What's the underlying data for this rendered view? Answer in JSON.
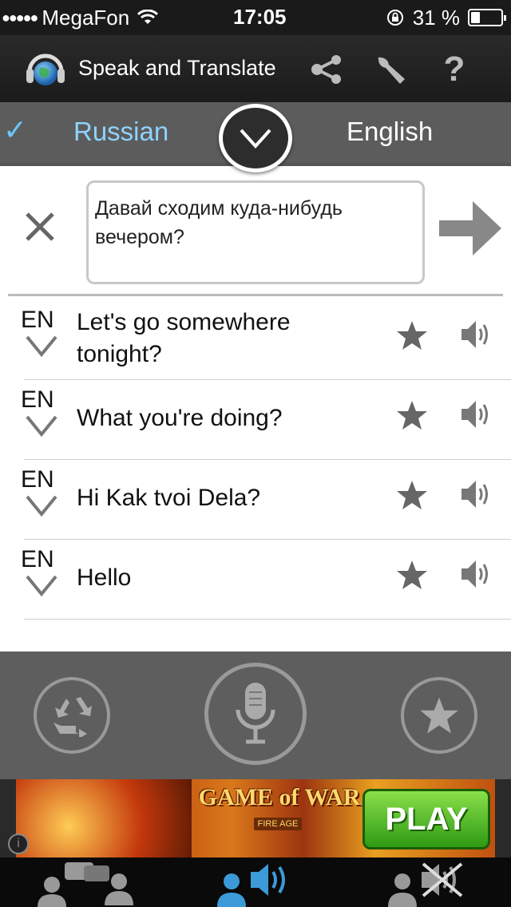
{
  "status_bar": {
    "carrier": "MegaFon",
    "time": "17:05",
    "battery_percent": "31 %",
    "battery_level": 0.31
  },
  "header": {
    "title": "Speak and Translate"
  },
  "languages": {
    "source": "Russian",
    "target": "English"
  },
  "input": {
    "text": "Давай сходим куда-нибудь вечером?"
  },
  "history": [
    {
      "code": "EN",
      "text": "Let's go somewhere tonight?"
    },
    {
      "code": "EN",
      "text": "What you're doing?"
    },
    {
      "code": "EN",
      "text": "Hi Kak tvoi Dela?"
    },
    {
      "code": "EN",
      "text": "Hello"
    }
  ],
  "ad": {
    "title": "GAME of WAR",
    "subtitle": "FIRE AGE",
    "cta": "PLAY"
  },
  "colors": {
    "accent": "#8ed3ff",
    "active_tab": "#3d9ad9",
    "panel": "#5e5e5e"
  }
}
